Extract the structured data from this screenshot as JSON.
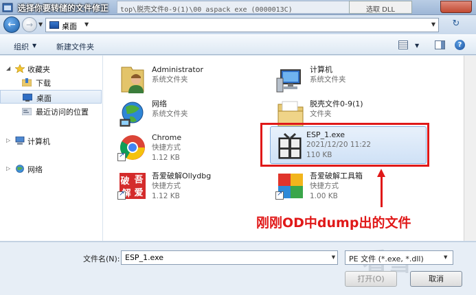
{
  "window": {
    "title": "选择你要转储的文件修正",
    "background_path": "top\\脱壳文件0-9(1)\\00 aspack exe (0000013C)",
    "background_button": "选取 DLL"
  },
  "address": {
    "location": "桌面"
  },
  "toolbar": {
    "organize": "组织",
    "new_folder": "新建文件夹"
  },
  "sidebar": {
    "favorites": "收藏夹",
    "items": [
      {
        "label": "下载"
      },
      {
        "label": "桌面"
      },
      {
        "label": "最近访问的位置"
      }
    ],
    "computer": "计算机",
    "network": "网络"
  },
  "files": [
    {
      "name": "Administrator",
      "sub1": "系统文件夹",
      "sub2": ""
    },
    {
      "name": "计算机",
      "sub1": "系统文件夹",
      "sub2": ""
    },
    {
      "name": "网络",
      "sub1": "系统文件夹",
      "sub2": ""
    },
    {
      "name": "脱壳文件0-9(1)",
      "sub1": "文件夹",
      "sub2": ""
    },
    {
      "name": "Chrome",
      "sub1": "快捷方式",
      "sub2": "1.12 KB"
    },
    {
      "name": "ESP_1.exe",
      "sub1": "2021/12/20 11:22",
      "sub2": "110 KB"
    },
    {
      "name": "吾爱破解Ollydbg",
      "sub1": "快捷方式",
      "sub2": "1.12 KB"
    },
    {
      "name": "吾爱破解工具箱",
      "sub1": "快捷方式",
      "sub2": "1.00 KB"
    }
  ],
  "annotation": "刚刚OD中dump出的文件",
  "bottom": {
    "filename_label": "文件名(N):",
    "filename_value": "ESP_1.exe",
    "filetype": "PE 文件 (*.exe, *.dll)",
    "open_button": "打开(O)",
    "cancel_button": "取消",
    "watermark": "看雪"
  },
  "icons": {
    "od_logo_chars": [
      "破",
      "吾",
      "解",
      "爱"
    ]
  }
}
